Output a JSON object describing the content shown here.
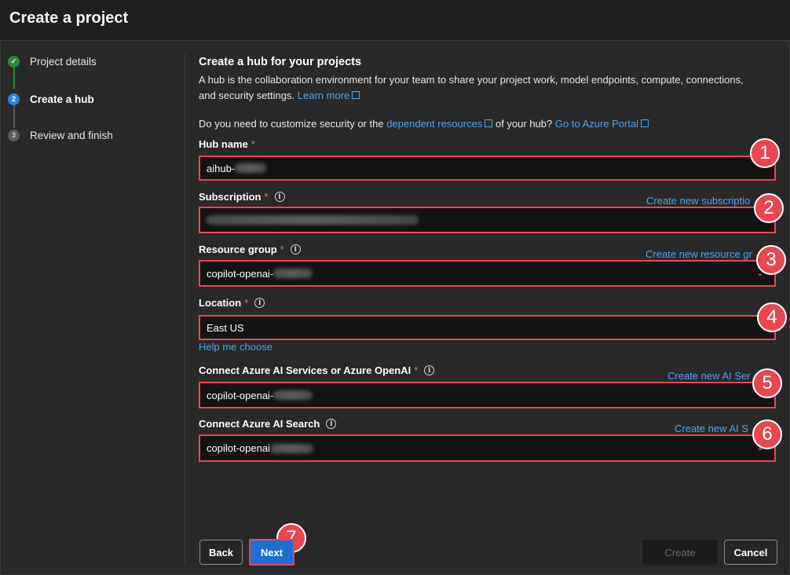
{
  "window": {
    "title": "Create a project"
  },
  "steps": [
    {
      "label": "Project details",
      "marker": "✓",
      "state": "done"
    },
    {
      "label": "Create a hub",
      "marker": "2",
      "state": "active"
    },
    {
      "label": "Review and finish",
      "marker": "3",
      "state": "todo"
    }
  ],
  "section": {
    "heading": "Create a hub for your projects",
    "description": "A hub is the collaboration environment for your team to share your project work, model endpoints, compute, connections, and security settings.",
    "learn_more": "Learn more",
    "question_prefix": "Do you need to customize security or the",
    "question_link1": "dependent resources",
    "question_mid": "of your hub?",
    "question_link2": "Go to Azure Portal"
  },
  "fields": {
    "hub_name": {
      "label": "Hub name",
      "required": "*",
      "value": "aihub-"
    },
    "subscription": {
      "label": "Subscription",
      "required": "*",
      "value": "",
      "create_link": "Create new subscriptio"
    },
    "resource_group": {
      "label": "Resource group",
      "required": "*",
      "value": "copilot-openai-",
      "create_link": "Create new resource gr"
    },
    "location": {
      "label": "Location",
      "required": "*",
      "value": "East US",
      "help_link": "Help me choose"
    },
    "ai_services": {
      "label": "Connect Azure AI Services or Azure OpenAI",
      "required": "*",
      "value": "copilot-openai-",
      "create_link": "Create new AI Ser"
    },
    "ai_search": {
      "label": "Connect Azure AI Search",
      "value": "copilot-openai",
      "create_link": "Create new AI S"
    }
  },
  "badges": [
    "1",
    "2",
    "3",
    "4",
    "5",
    "6",
    "7"
  ],
  "buttons": {
    "back": "Back",
    "next": "Next",
    "create": "Create",
    "cancel": "Cancel"
  },
  "colors": {
    "accent": "#2f84d6",
    "link": "#4fa3f0",
    "highlight": "#e8474f",
    "success": "#2d8a3e"
  }
}
